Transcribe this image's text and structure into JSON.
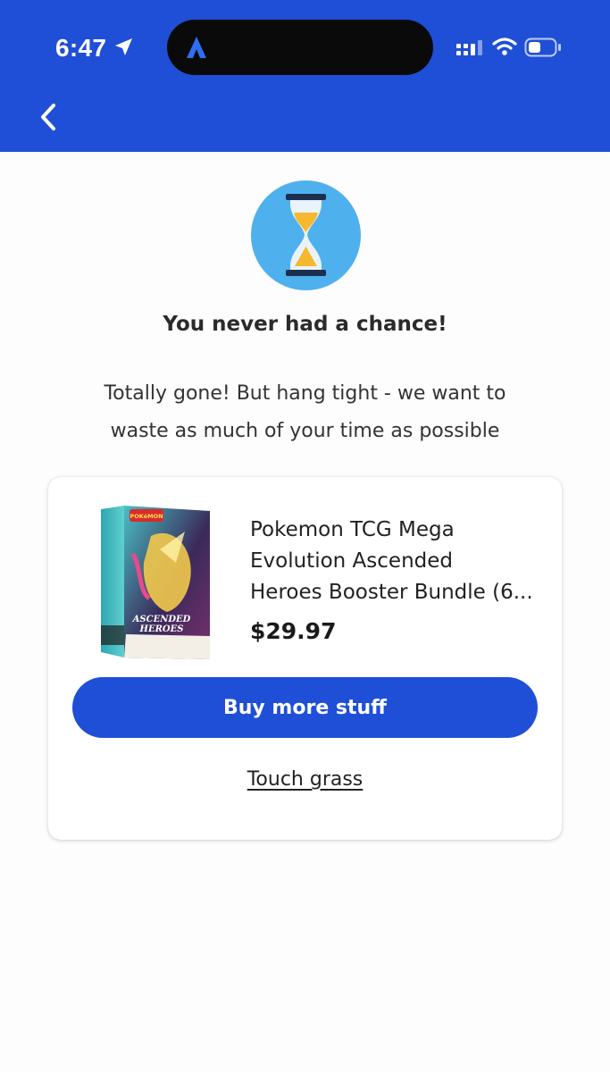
{
  "status_bar": {
    "time": "6:47",
    "icons": [
      "location-arrow-icon",
      "app-logo-icon",
      "cellular-signal-icon",
      "wifi-icon",
      "battery-icon"
    ]
  },
  "nav": {
    "back_icon": "chevron-left-icon"
  },
  "hero": {
    "icon": "hourglass-icon",
    "title": "You never had a chance!",
    "subtitle_line1": "Totally gone! But hang tight - we want to",
    "subtitle_line2": "waste as much of your time as possible"
  },
  "product": {
    "title_line1": "Pokemon TCG Mega",
    "title_line2": "Evolution Ascended",
    "title_line3": "Heroes Booster Bundle (6...",
    "price": "$29.97",
    "image_text_brand": "POKéMON",
    "image_text_line1": "ASCENDED",
    "image_text_line2": "HEROES"
  },
  "actions": {
    "primary_label": "Buy more stuff",
    "secondary_label": "Touch grass"
  },
  "colors": {
    "brand_blue": "#1f4fd6",
    "badge_blue": "#4fb0ee",
    "hourglass_sand": "#f5b82e",
    "hourglass_frame": "#1b2f4f"
  }
}
